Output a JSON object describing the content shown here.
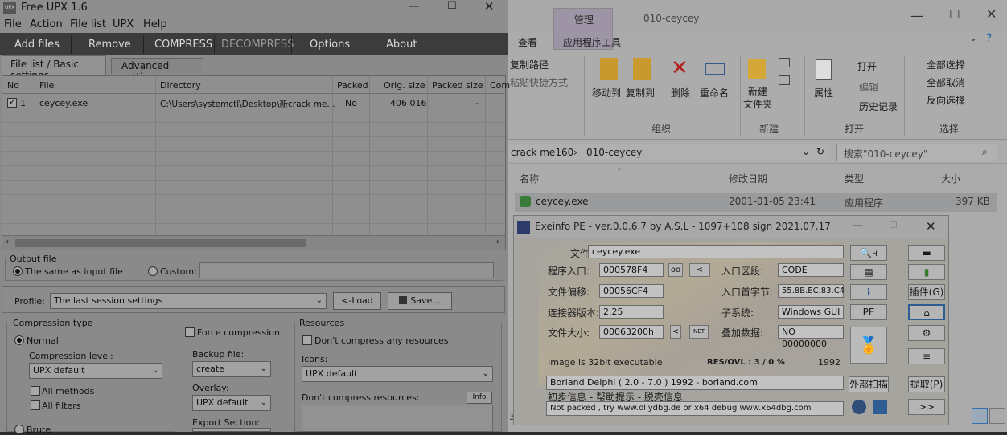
{
  "upx": {
    "title": "Free UPX 1.6",
    "menu": [
      "File",
      "Action",
      "File list",
      "UPX",
      "Help"
    ],
    "toolbar": [
      "Add files",
      "Remove",
      "COMPRESS",
      "DECOMPRESS",
      "Options",
      "About"
    ],
    "tabs": [
      "File list / Basic settings",
      "Advanced settings"
    ],
    "grid": {
      "columns": [
        "No",
        "File",
        "Directory",
        "Packed",
        "Orig. size",
        "Packed size",
        "Com"
      ],
      "rows": [
        {
          "no": "1",
          "file": "ceycey.exe",
          "dir": "C:\\Users\\systemctl\\Desktop\\新crack me...",
          "packed": "No",
          "orig": "406 016",
          "psize": "-"
        }
      ]
    },
    "output": {
      "label": "Output file",
      "same": "The same as input file",
      "custom": "Custom:"
    },
    "profile": {
      "label": "Profile:",
      "value": "The last session settings",
      "load": "<-Load",
      "save": "Save..."
    },
    "compression": {
      "title": "Compression type",
      "normal": "Normal",
      "level_label": "Compression level:",
      "level_value": "UPX default",
      "all_methods": "All methods",
      "all_filters": "All filters",
      "brute": "Brute"
    },
    "force": "Force compression",
    "backup": {
      "label": "Backup file:",
      "value": "create"
    },
    "overlay": {
      "label": "Overlay:",
      "value": "UPX default"
    },
    "export": {
      "label": "Export Section:"
    },
    "resources": {
      "title": "Resources",
      "dont": "Don't compress any resources",
      "icons_label": "Icons:",
      "icons_value": "UPX default",
      "dont_res": "Don't compress resources:",
      "info": "Info"
    }
  },
  "explorer": {
    "window_title": "010-ceycey",
    "tab_manage": "管理",
    "tab_view": "查看",
    "tab_apptools": "应用程序工具",
    "copy_path": "复制路径",
    "paste_shortcut": "粘贴快捷方式",
    "move_to": "移动到",
    "copy_to": "复制到",
    "delete": "删除",
    "rename": "重命名",
    "new_folder": "新建\n文件夹",
    "properties": "属性",
    "open": "打开",
    "edit": "编辑",
    "history": "历史记录",
    "select_all": "全部选择",
    "select_none": "全部取消",
    "invert": "反向选择",
    "group_organize": "组织",
    "group_new": "新建",
    "group_open": "打开",
    "group_select": "选择",
    "breadcrumb": [
      "crack me160",
      "010-ceycey"
    ],
    "search_placeholder": "搜索\"010-ceycey\"",
    "columns": [
      "名称",
      "修改日期",
      "类型",
      "大小"
    ],
    "file": {
      "name": "ceycey.exe",
      "date": "2001-01-05 23:41",
      "type": "应用程序",
      "size": "397 KB"
    },
    "stray_digit": "3"
  },
  "exeinfo": {
    "title": "Exeinfo PE - ver.0.0.6.7   by A.S.L -  1097+108 sign  2021.07.17",
    "file_label": "文件(F):",
    "file_value": "ceycey.exe",
    "entry_label": "程序入口:",
    "entry_value": "000578F4",
    "oo": "oo",
    "lt": "<",
    "offset_label": "文件偏移:",
    "offset_value": "00056CF4",
    "linker_label": "连接器版本:",
    "linker_value": "2.25",
    "size_label": "文件大小:",
    "size_value": "00063200h",
    "net": "NET",
    "ep_section_label": "入口区段:",
    "ep_section_value": "CODE",
    "first_bytes_label": "入口首字节:",
    "first_bytes_value": "55.8B.EC.83.C4",
    "subsystem_label": "子系统:",
    "subsystem_value": "Windows GUI",
    "overlay_label": "叠加数据:",
    "overlay_value": "NO  00000000",
    "image_info": "Image is 32bit executable",
    "res_label": "RES/OVL : 3 / 0 %",
    "year": "1992",
    "detect": "Borland Delphi ( 2.0 - 7.0 ) 1992 - borland.com",
    "hint_line": "初步信息 - 帮助提示 - 脱壳信息",
    "not_packed": "Not packed , try  www.ollydbg.de or x64 debug www.x64dbg.com",
    "btn_scan": "外部扫描",
    "btn_plugins": "插件(G)",
    "btn_extract": "提取(P)",
    "btn_pe": "PE",
    "btn_h": "H",
    "btn_next": ">>"
  }
}
